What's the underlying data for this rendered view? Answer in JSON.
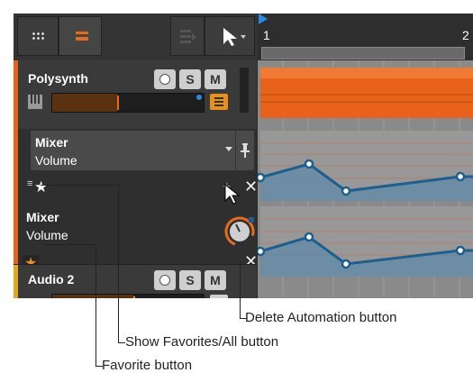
{
  "ruler": {
    "marker_1": "1",
    "marker_2": "2"
  },
  "tracks": [
    {
      "name": "Polysynth",
      "color": "#e8621c",
      "solo": "S",
      "mute": "M"
    },
    {
      "name": "Audio 2",
      "color": "#e0a81c",
      "solo": "S",
      "mute": "M"
    }
  ],
  "automation_lanes": [
    {
      "device": "Mixer",
      "parameter": "Volume"
    },
    {
      "device": "Mixer",
      "parameter": "Volume"
    }
  ],
  "colors": {
    "accent": "#e86a1c",
    "automation_line": "#1d5f8e",
    "automation_fill": "#5d8aa8"
  },
  "callouts": {
    "delete_automation": "Delete Automation button",
    "show_favorites": "Show Favorites/All button",
    "favorite": "Favorite button"
  }
}
